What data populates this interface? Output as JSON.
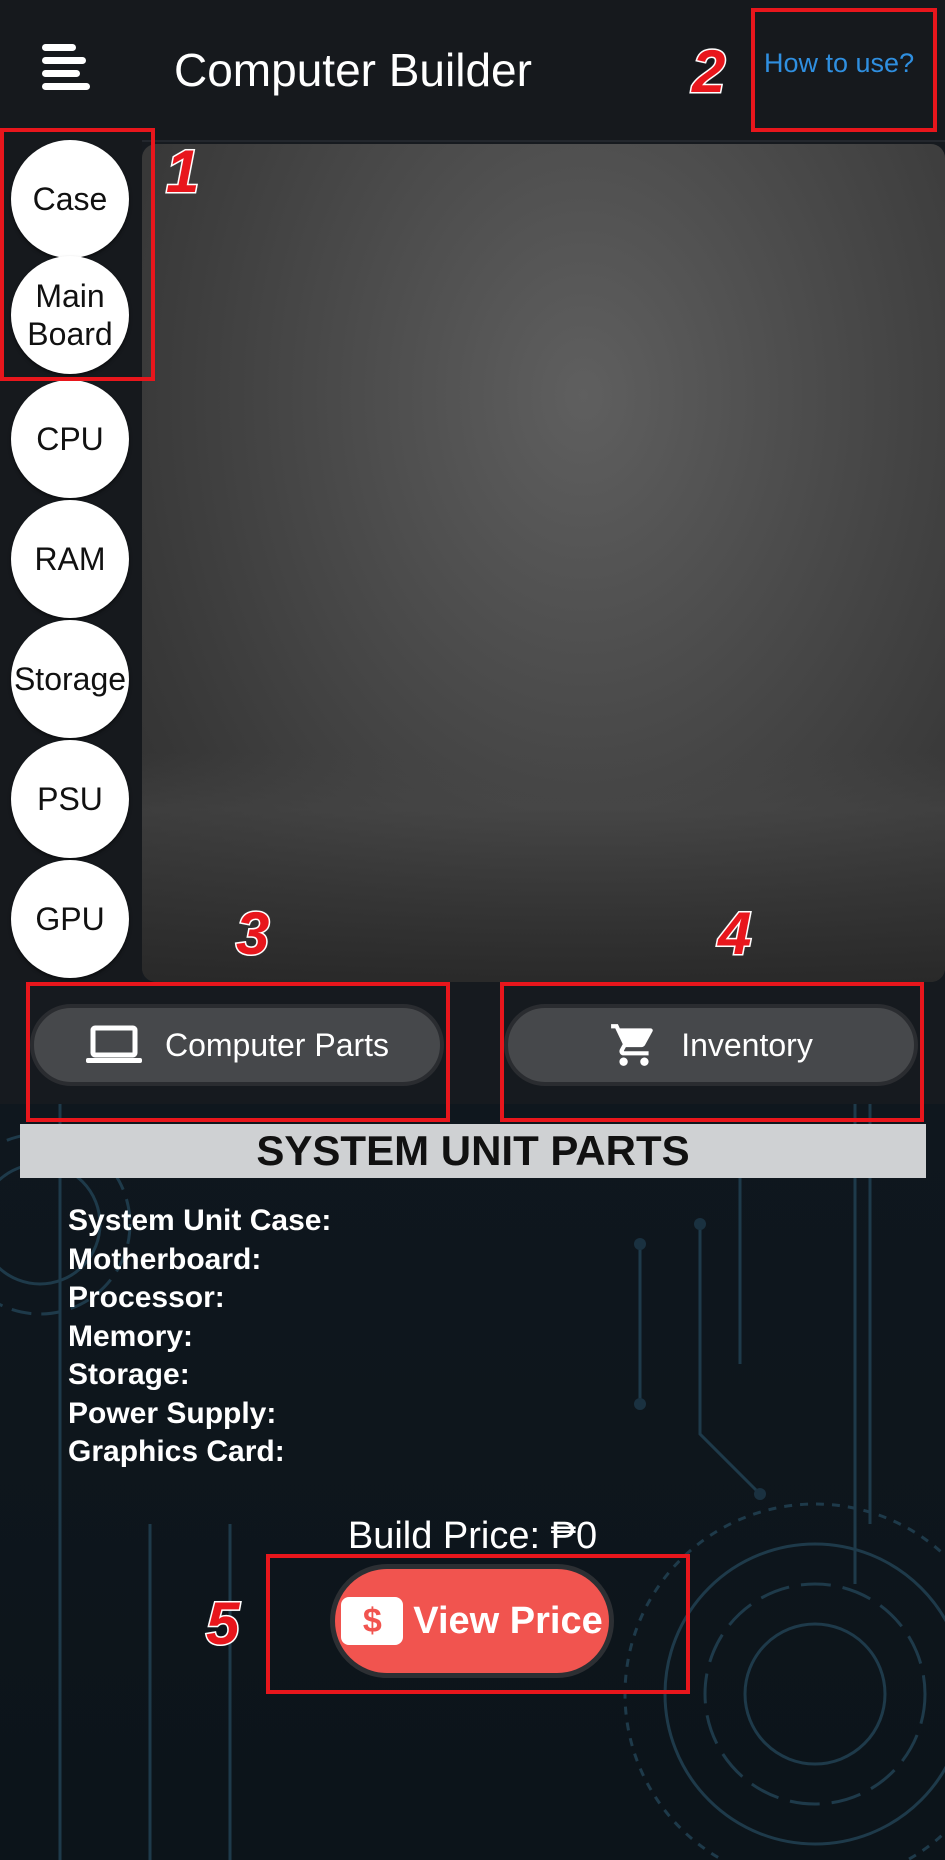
{
  "app_bar": {
    "title": "Computer Builder",
    "help_link": "How to use?"
  },
  "categories": [
    {
      "label": "Case"
    },
    {
      "label": "Main Board"
    },
    {
      "label": "CPU"
    },
    {
      "label": "RAM"
    },
    {
      "label": "Storage"
    },
    {
      "label": "PSU"
    },
    {
      "label": "GPU"
    }
  ],
  "actions": {
    "computer_parts_label": "Computer Parts",
    "inventory_label": "Inventory"
  },
  "parts_panel": {
    "header": "SYSTEM UNIT PARTS",
    "rows": [
      {
        "label": "System Unit Case:"
      },
      {
        "label": "Motherboard:"
      },
      {
        "label": "Processor:"
      },
      {
        "label": "Memory:"
      },
      {
        "label": "Storage:"
      },
      {
        "label": "Power Supply:"
      },
      {
        "label": "Graphics Card:"
      }
    ],
    "build_price": "Build Price: ₱0",
    "view_price_label": "View Price",
    "dollar_glyph": "$"
  },
  "annotations": {
    "one": "1",
    "two": "2",
    "three": "3",
    "four": "4",
    "five": "5"
  },
  "colors": {
    "accent_link": "#2f8fe0",
    "view_price_button": "#f1544f",
    "annotation_red": "#e8161c",
    "action_button": "#46484b"
  },
  "icons": {
    "menu": "menu-icon",
    "laptop": "laptop-icon",
    "cart": "cart-icon",
    "price": "dollar-badge-icon"
  }
}
